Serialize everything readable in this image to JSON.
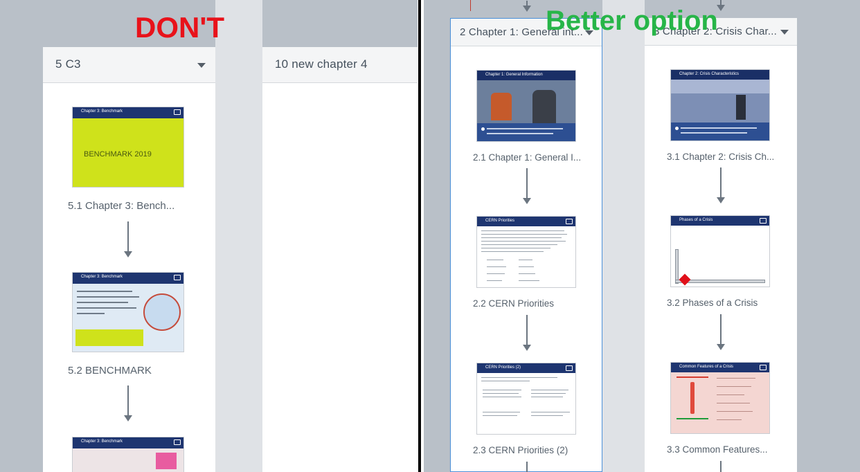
{
  "annotations": {
    "dont": "DON'T",
    "better": "Better option"
  },
  "left": {
    "columns": [
      {
        "title": "5 C3",
        "has_dropdown": true,
        "slides": [
          {
            "caption": "5.1 Chapter 3: Bench...",
            "thumb_text": "BENCHMARK 2019"
          },
          {
            "caption": "5.2 BENCHMARK"
          },
          {
            "caption": ""
          }
        ]
      },
      {
        "title": "10 new chapter 4",
        "has_dropdown": false,
        "slides": []
      }
    ]
  },
  "right": {
    "columns": [
      {
        "title": "2 Chapter 1: General int...",
        "selected": true,
        "slides": [
          {
            "caption": "2.1 Chapter 1: General I..."
          },
          {
            "caption": "2.2 CERN Priorities"
          },
          {
            "caption": "2.3 CERN Priorities (2)"
          }
        ]
      },
      {
        "title": "3 Chapter 2: Crisis Char...",
        "selected": false,
        "slides": [
          {
            "caption": "3.1 Chapter 2: Crisis Ch..."
          },
          {
            "caption": "3.2 Phases of a Crisis"
          },
          {
            "caption": "3.3 Common Features..."
          }
        ]
      }
    ]
  },
  "colors": {
    "workspace": "#b9c0c8",
    "title_bar": "#1e3570",
    "benchmark_bg": "#cfe21b",
    "dont": "#e8121a",
    "better": "#27b548",
    "selection": "#4a90d9"
  }
}
